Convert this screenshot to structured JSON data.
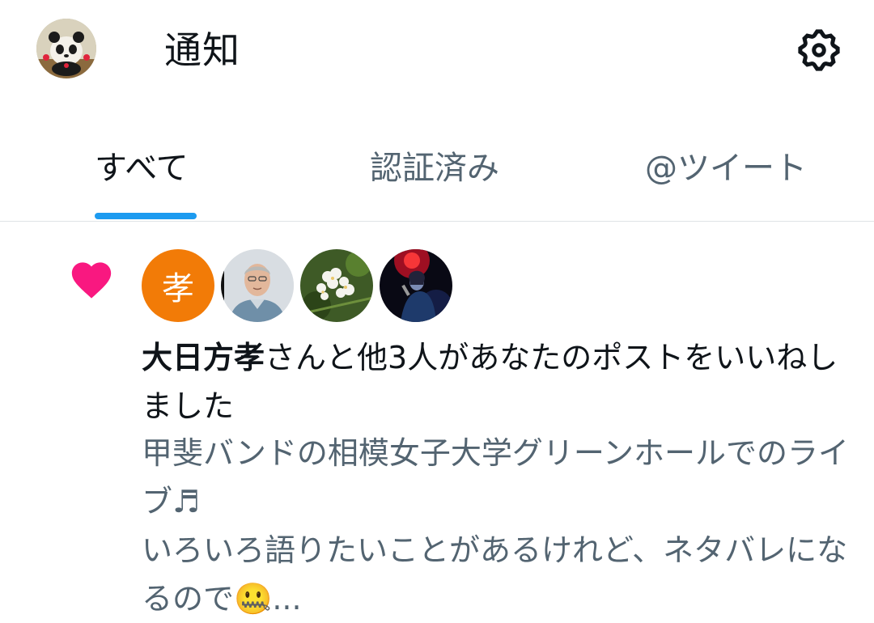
{
  "header": {
    "title": "通知",
    "avatar_icon": "user-avatar-icon",
    "settings_icon": "gear-icon"
  },
  "tabs": [
    {
      "label": "すべて",
      "active": true
    },
    {
      "label": "認証済み",
      "active": false
    },
    {
      "label": "@ツイート",
      "active": false
    }
  ],
  "colors": {
    "accent": "#1d9bf0",
    "heart": "#f91880",
    "primary_text": "#0f1419",
    "secondary_text": "#536471",
    "avatar_orange": "#f27b07"
  },
  "notification": {
    "type_icon": "heart-icon",
    "avatars": [
      {
        "initial": "孝"
      },
      {
        "icon": "person-photo-icon"
      },
      {
        "icon": "flower-photo-icon"
      },
      {
        "icon": "concert-photo-icon"
      }
    ],
    "actor_name": "大日方孝",
    "message_suffix": "さんと他3人があなたのポストをいいねしました",
    "post_snippet": "甲斐バンドの相模女子大学グリーンホールでのライブ♬\nいろいろ語りたいことがあるけれど、ネタバレになるので🤐..."
  }
}
